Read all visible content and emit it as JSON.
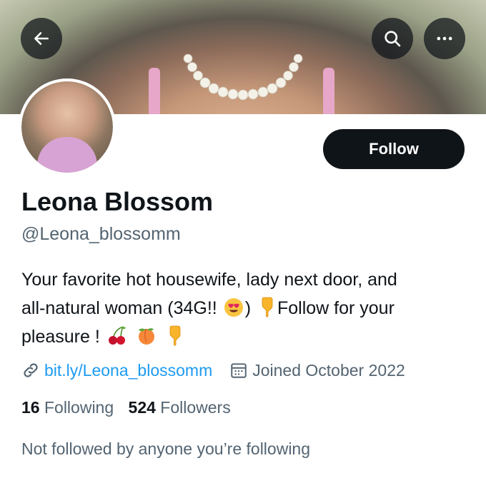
{
  "header": {
    "back_icon": "arrow-left-icon",
    "search_icon": "search-icon",
    "more_icon": "more-horizontal-icon"
  },
  "profile": {
    "name": "Leona Blossom",
    "handle": "@Leona_blossomm",
    "follow_label": "Follow",
    "bio_line1": "Your favorite hot housewife, lady next door, and",
    "bio_line2_pre": "all-natural woman (34G!!",
    "bio_line2_mid": ")",
    "bio_line2_post": "Follow for your",
    "bio_line3": "pleasure !",
    "bio_emojis": [
      "smiling-face-with-heart-eyes",
      "backhand-index-pointing-down",
      "cherries",
      "peach",
      "backhand-index-pointing-down"
    ],
    "link_text": "bit.ly/Leona_blossomm",
    "joined_text": "Joined October 2022",
    "following_count": "16",
    "following_label": "Following",
    "followers_count": "524",
    "followers_label": "Followers",
    "not_followed_text": "Not followed by anyone you’re following"
  },
  "colors": {
    "accent": "#1d9bf0",
    "primary_text": "#0f1419",
    "secondary_text": "#536471",
    "follow_button_bg": "#0f1419"
  }
}
